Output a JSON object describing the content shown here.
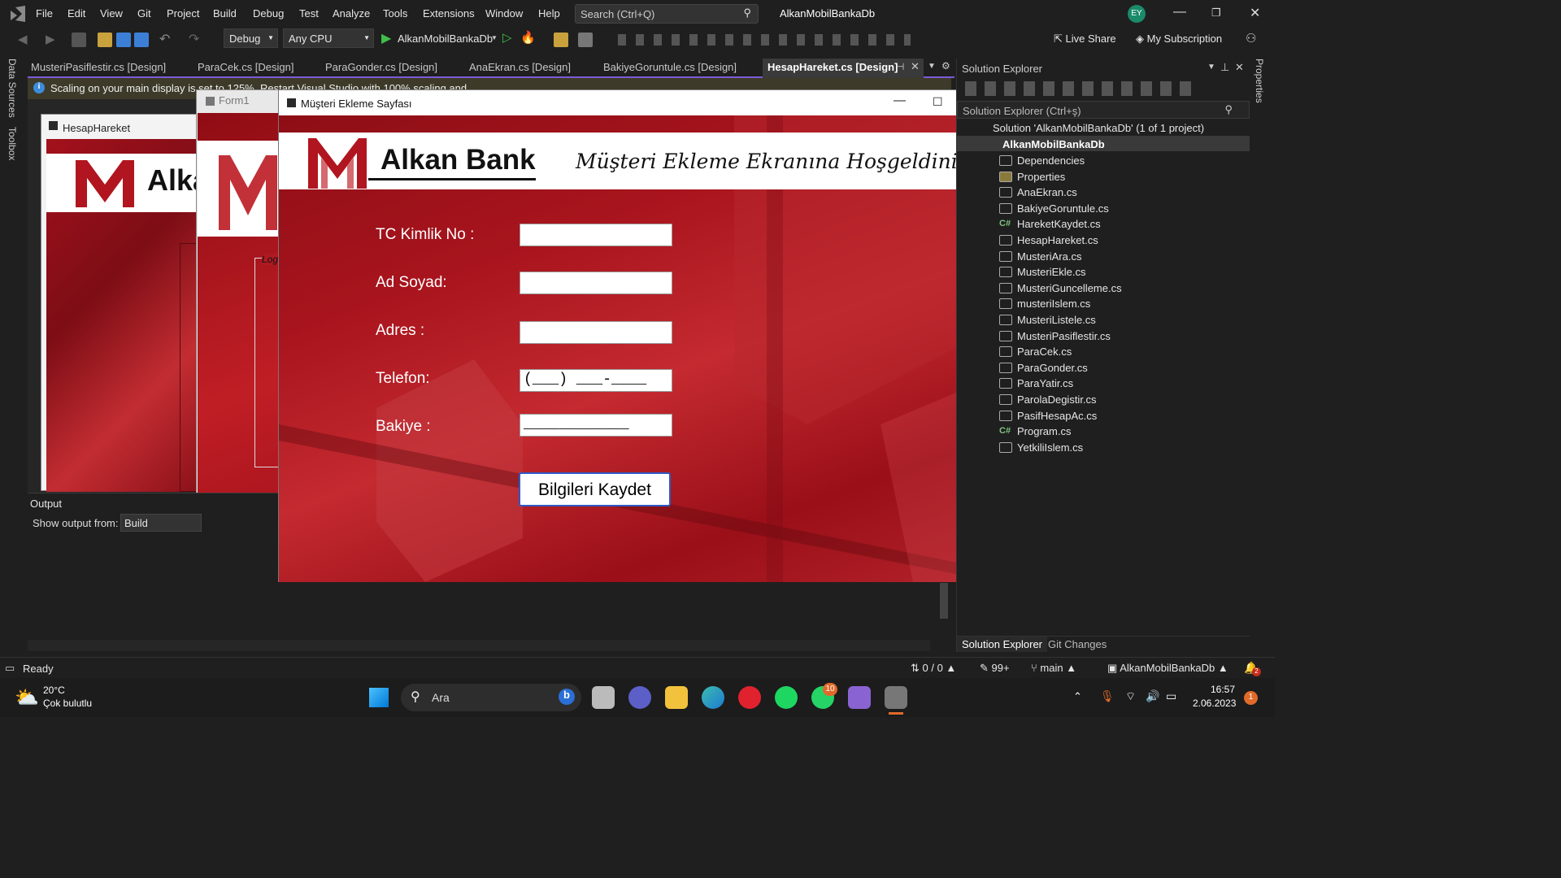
{
  "menu": [
    "File",
    "Edit",
    "View",
    "Git",
    "Project",
    "Build",
    "Debug",
    "Test",
    "Analyze",
    "Tools",
    "Extensions",
    "Window",
    "Help"
  ],
  "search": {
    "placeholder": "Search (Ctrl+Q)"
  },
  "app_title": "AlkanMobilBankaDb",
  "user_initials": "EY",
  "toolbar": {
    "config": "Debug",
    "platform": "Any CPU",
    "run_target": "AlkanMobilBankaDb",
    "live_share": "Live Share",
    "subscription": "My Subscription"
  },
  "side_tabs": {
    "data_sources": "Data Sources",
    "toolbox": "Toolbox",
    "properties": "Properties"
  },
  "doc_tabs": [
    "MusteriPasiflestir.cs [Design]",
    "ParaCek.cs [Design]",
    "ParaGonder.cs [Design]",
    "AnaEkran.cs [Design]",
    "BakiyeGoruntule.cs [Design]",
    "HesapHareket.cs [Design]"
  ],
  "infobar": {
    "text": "Scaling on your main display is set to 125%. Restart Visual Studio with 100% scaling and"
  },
  "bg_windows": {
    "hesap_title": "HesapHareket",
    "hesap_logo": "Alka",
    "form1_title": "Form1",
    "form1_text": "Log"
  },
  "output": {
    "title": "Output",
    "show_from_label": "Show output from:",
    "show_from_value": "Build"
  },
  "form": {
    "title": "Müşteri Ekleme Sayfası",
    "bank_name": "Alkan Bank",
    "welcome": "Müşteri Ekleme Ekranına Hoşgeldiniz",
    "labels": {
      "tc": "TC Kimlik No :",
      "name": "Ad Soyad:",
      "address": "Adres :",
      "phone": "Telefon:",
      "balance": "Bakiye :"
    },
    "phone_mask": "(___) ___-____",
    "balance_mask": "____________",
    "save_button": "Bilgileri Kaydet"
  },
  "solution_explorer": {
    "title": "Solution Explorer",
    "search_placeholder": "Solution Explorer (Ctrl+ş)",
    "solution": "Solution 'AlkanMobilBankaDb' (1 of 1 project)",
    "project": "AlkanMobilBankaDb",
    "items": [
      "Dependencies",
      "Properties",
      "AnaEkran.cs",
      "BakiyeGoruntule.cs",
      "HareketKaydet.cs",
      "HesapHareket.cs",
      "MusteriAra.cs",
      "MusteriEkle.cs",
      "MusteriGuncelleme.cs",
      "musteriIslem.cs",
      "MusteriListele.cs",
      "MusteriPasiflestir.cs",
      "ParaCek.cs",
      "ParaGonder.cs",
      "ParaYatir.cs",
      "ParolaDegistir.cs",
      "PasifHesapAc.cs",
      "Program.cs",
      "YetkiliIslem.cs"
    ],
    "bottom_tabs": [
      "Solution Explorer",
      "Git Changes"
    ]
  },
  "status": {
    "ready": "Ready",
    "lines": "0 / 0",
    "edits": "99+",
    "branch": "main",
    "repo": "AlkanMobilBankaDb",
    "notif": "2"
  },
  "taskbar": {
    "weather_temp": "20°C",
    "weather_desc": "Çok bulutlu",
    "search": "Ara",
    "time": "16:57",
    "date": "2.06.2023",
    "whatsapp_badge": "10",
    "notif_badge": "1"
  },
  "colors": {
    "accent": "#2f58c5",
    "bank_red": "#b1151f",
    "vs_purple": "#8a63d2"
  }
}
